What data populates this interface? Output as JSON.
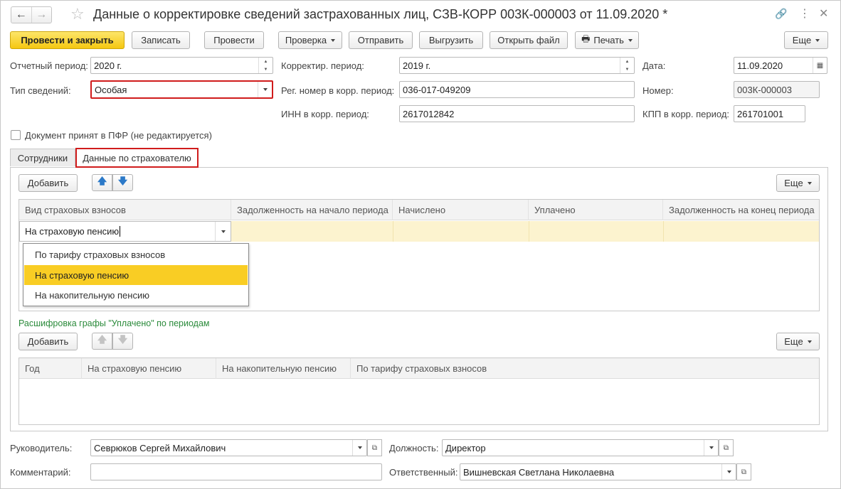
{
  "title": "Данные о корректировке сведений застрахованных лиц, СЗВ-КОРР 003К-000003 от 11.09.2020 *",
  "toolbar": {
    "post_close": "Провести и закрыть",
    "save": "Записать",
    "post": "Провести",
    "check": "Проверка",
    "send": "Отправить",
    "upload": "Выгрузить",
    "open_file": "Открыть файл",
    "print": "Печать",
    "more": "Еще"
  },
  "fields": {
    "report_period_label": "Отчетный период:",
    "report_period": "2020 г.",
    "info_type_label": "Тип сведений:",
    "info_type": "Особая",
    "corr_period_label": "Корректир. период:",
    "corr_period": "2019 г.",
    "reg_num_label": "Рег. номер в корр. период:",
    "reg_num": "036-017-049209",
    "inn_label": "ИНН в корр. период:",
    "inn": "2617012842",
    "date_label": "Дата:",
    "date": "11.09.2020",
    "number_label": "Номер:",
    "number": "003К-000003",
    "kpp_label": "КПП в корр. период:",
    "kpp": "261701001",
    "accepted_label": "Документ принят в ПФР (не редактируется)"
  },
  "tabs": [
    "Сотрудники",
    "Данные по страхователю"
  ],
  "table1": {
    "add": "Добавить",
    "more": "Еще",
    "headers": [
      "Вид страховых взносов",
      "Задолженность на начало периода",
      "Начислено",
      "Уплачено",
      "Задолженность на конец периода"
    ],
    "row_value": "На страховую пенсию",
    "dropdown": [
      "По тарифу страховых взносов",
      "На страховую пенсию",
      "На накопительную пенсию"
    ]
  },
  "table2": {
    "caption": "Расшифровка графы \"Уплачено\" по периодам",
    "add": "Добавить",
    "more": "Еще",
    "headers": [
      "Год",
      "На страховую пенсию",
      "На накопительную пенсию",
      "По тарифу страховых взносов"
    ]
  },
  "footer": {
    "head_label": "Руководитель:",
    "head": "Севрюков Сергей Михайлович",
    "position_label": "Должность:",
    "position": "Директор",
    "comment_label": "Комментарий:",
    "comment": "",
    "responsible_label": "Ответственный:",
    "responsible": "Вишневская Светлана Николаевна"
  },
  "colors": {
    "primary": "#f5c711",
    "highlight": "#f9cd24",
    "row": "#fcf3cf",
    "accent_red": "#d01c1c",
    "caption_green": "#2a8a3a"
  }
}
